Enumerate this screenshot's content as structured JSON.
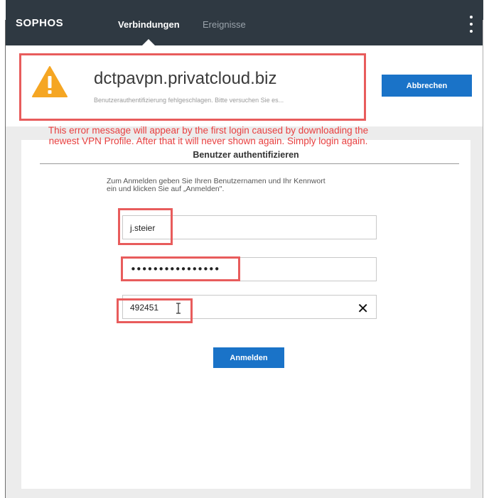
{
  "app": {
    "logo": "SOPHOS",
    "tabs": [
      {
        "label": "Verbindungen",
        "active": true
      },
      {
        "label": "Ereignisse",
        "active": false
      }
    ]
  },
  "connection": {
    "name": "dctpavpn.privatcloud.biz",
    "status": "Benutzerauthentifizierung fehlgeschlagen. Bitte versuchen Sie es...",
    "cancel_label": "Abbrechen"
  },
  "annotation": {
    "line1": "This error message will appear by the first login caused by downloading the",
    "line2": "newest VPN Profile. After that it will never shown again. Simply login again."
  },
  "auth": {
    "heading": "Benutzer authentifizieren",
    "instructions_line1": "Zum Anmelden geben Sie Ihren Benutzernamen und Ihr Kennwort",
    "instructions_line2": "ein und klicken Sie auf „Anmelden\".",
    "username": "j.steier",
    "password_mask": "••••••••••••••••",
    "otp": "492451",
    "login_label": "Anmelden"
  },
  "colors": {
    "topbar": "#2f3942",
    "accent": "#1a73c8",
    "warning": "#f5a623",
    "annotation": "#e85c5c"
  },
  "icons": {
    "warning": "warning-triangle-icon",
    "menu": "kebab-menu-icon",
    "clear": "close-icon",
    "cursor": "text-cursor-icon"
  }
}
